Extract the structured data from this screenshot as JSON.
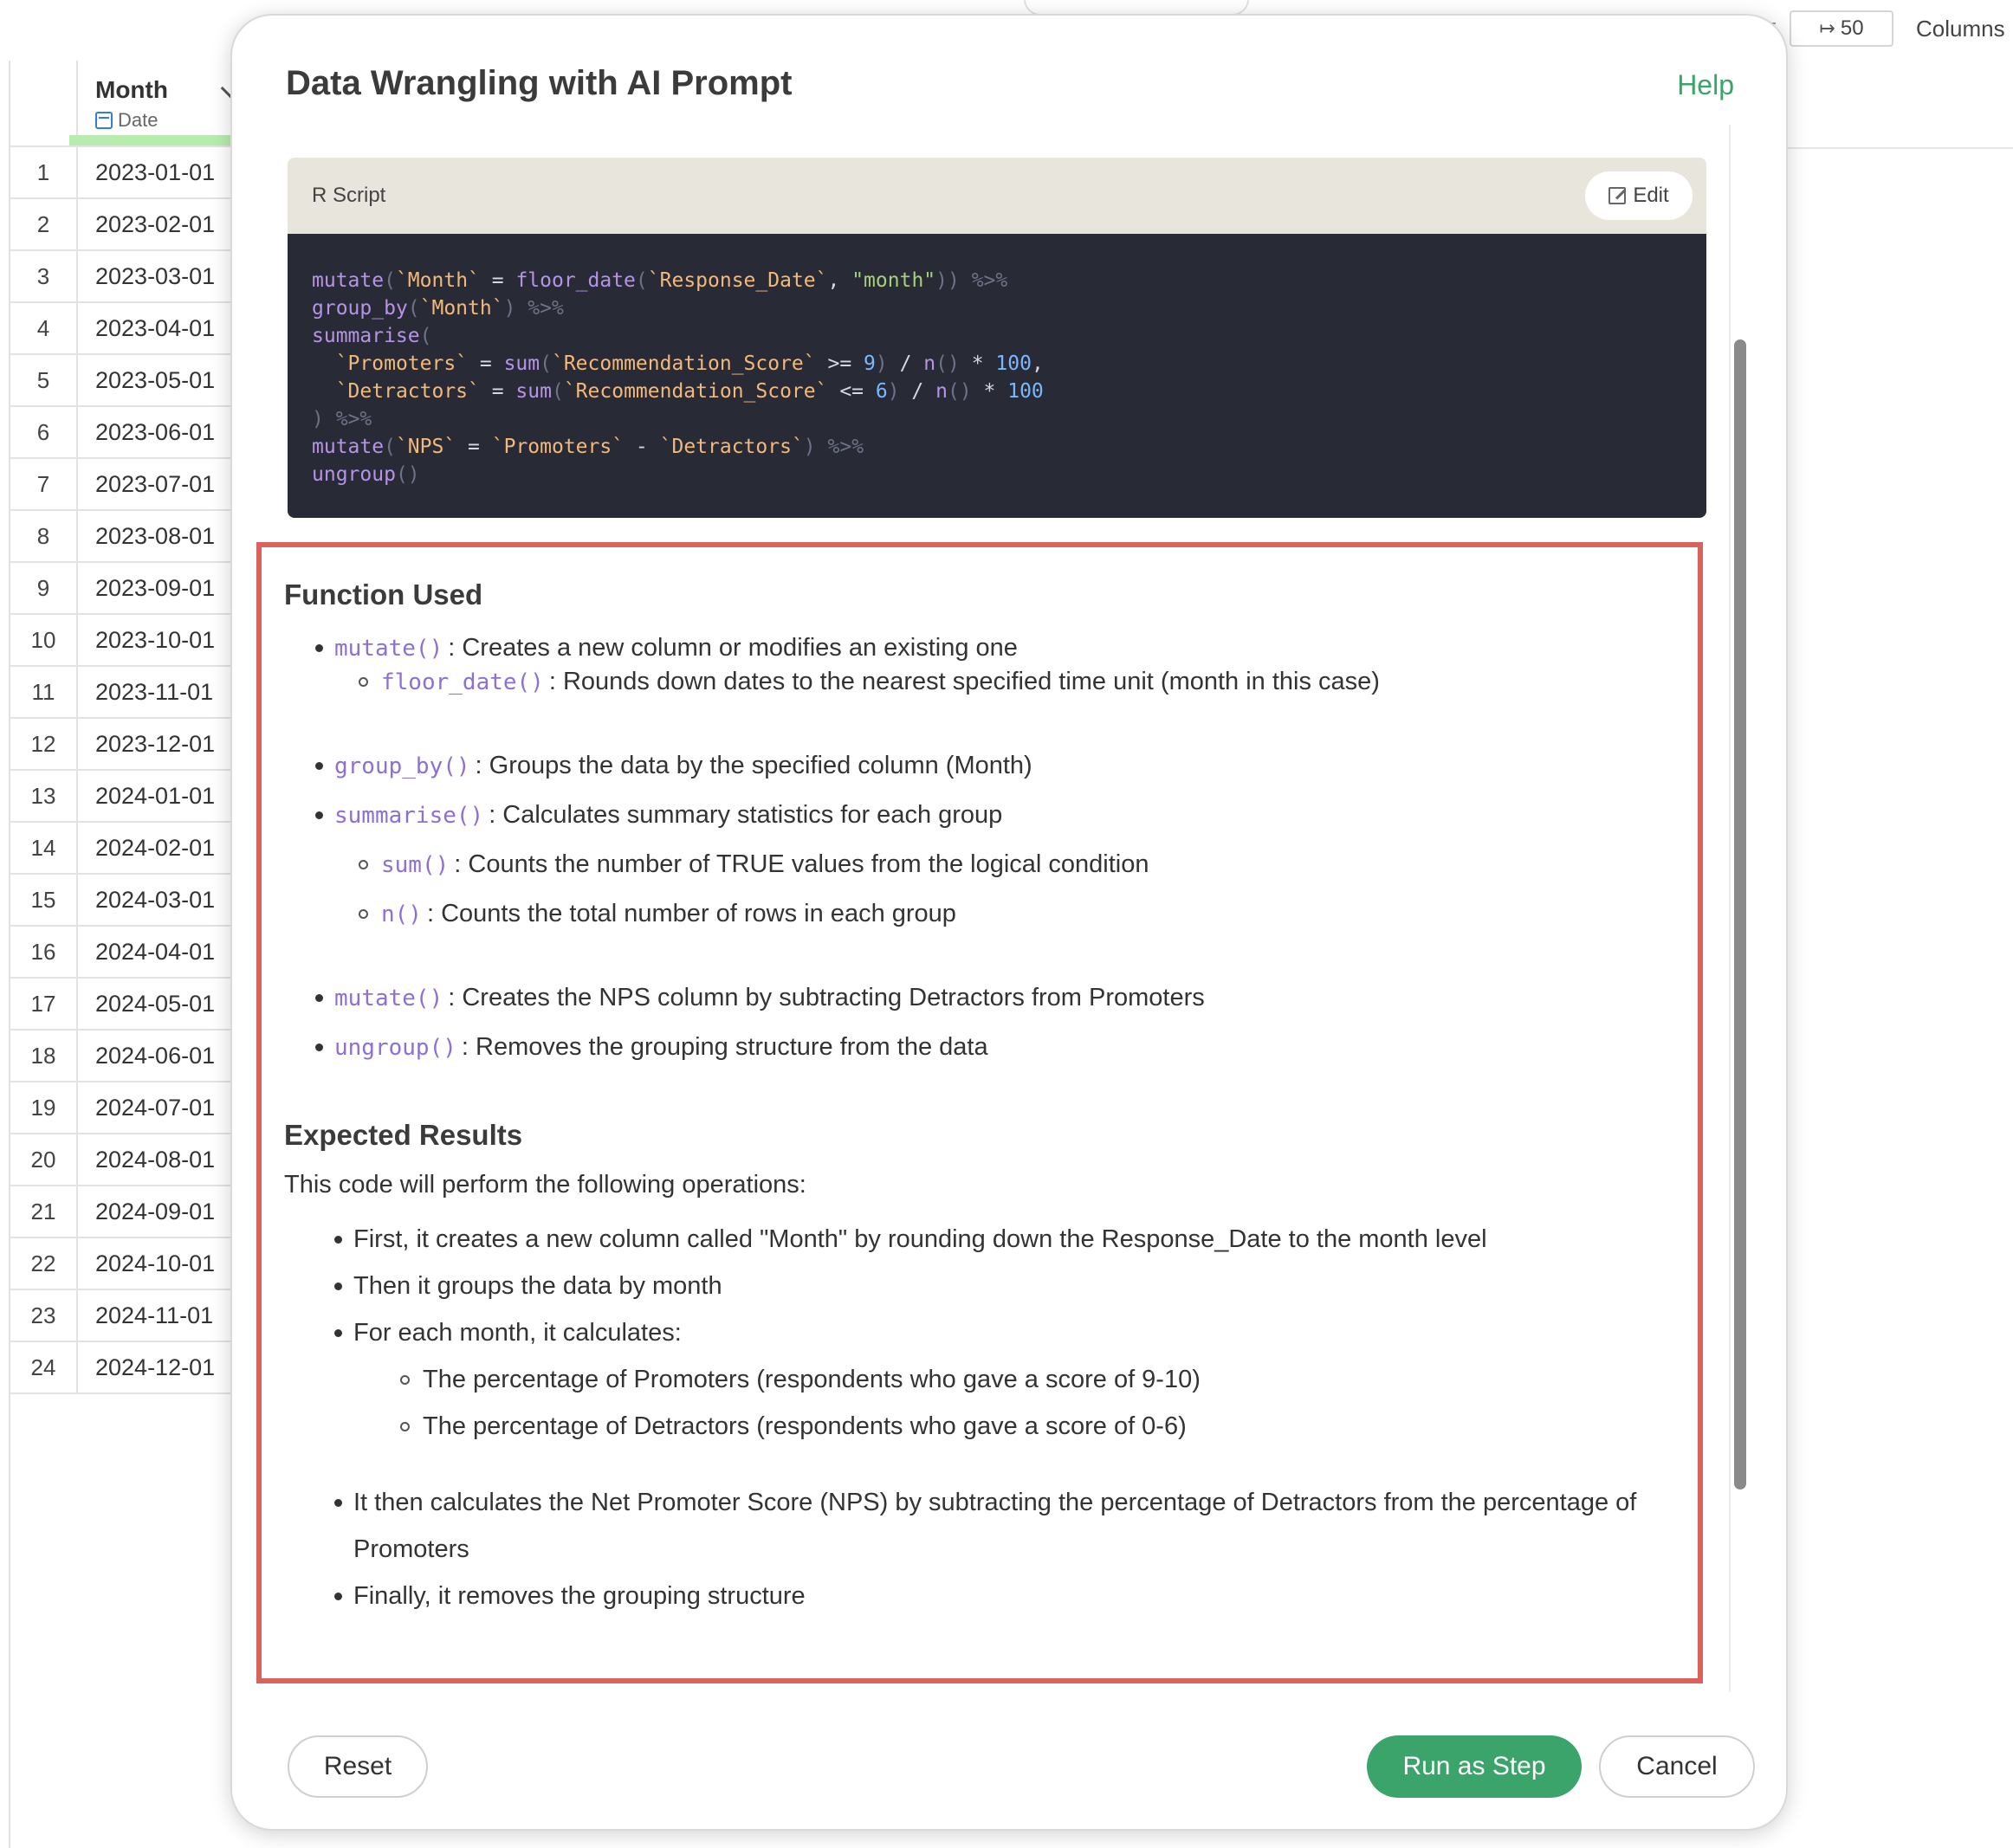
{
  "toolbar": {
    "rows_value": "50",
    "columns_label": "Columns"
  },
  "grid": {
    "column_name": "Month",
    "column_type": "Date",
    "rows": [
      {
        "idx": "1",
        "value": "2023-01-01"
      },
      {
        "idx": "2",
        "value": "2023-02-01"
      },
      {
        "idx": "3",
        "value": "2023-03-01"
      },
      {
        "idx": "4",
        "value": "2023-04-01"
      },
      {
        "idx": "5",
        "value": "2023-05-01"
      },
      {
        "idx": "6",
        "value": "2023-06-01"
      },
      {
        "idx": "7",
        "value": "2023-07-01"
      },
      {
        "idx": "8",
        "value": "2023-08-01"
      },
      {
        "idx": "9",
        "value": "2023-09-01"
      },
      {
        "idx": "10",
        "value": "2023-10-01"
      },
      {
        "idx": "11",
        "value": "2023-11-01"
      },
      {
        "idx": "12",
        "value": "2023-12-01"
      },
      {
        "idx": "13",
        "value": "2024-01-01"
      },
      {
        "idx": "14",
        "value": "2024-02-01"
      },
      {
        "idx": "15",
        "value": "2024-03-01"
      },
      {
        "idx": "16",
        "value": "2024-04-01"
      },
      {
        "idx": "17",
        "value": "2024-05-01"
      },
      {
        "idx": "18",
        "value": "2024-06-01"
      },
      {
        "idx": "19",
        "value": "2024-07-01"
      },
      {
        "idx": "20",
        "value": "2024-08-01"
      },
      {
        "idx": "21",
        "value": "2024-09-01"
      },
      {
        "idx": "22",
        "value": "2024-10-01"
      },
      {
        "idx": "23",
        "value": "2024-11-01"
      },
      {
        "idx": "24",
        "value": "2024-12-01"
      }
    ]
  },
  "modal": {
    "title": "Data Wrangling with AI Prompt",
    "help_label": "Help",
    "script_label": "R Script",
    "edit_label": "Edit",
    "code_lines": [
      [
        [
          "fn",
          "mutate"
        ],
        [
          "pun",
          "("
        ],
        [
          "bt",
          "`Month`"
        ],
        [
          "op",
          " = "
        ],
        [
          "fn",
          "floor_date"
        ],
        [
          "pun",
          "("
        ],
        [
          "bt",
          "`Response_Date`"
        ],
        [
          "op",
          ", "
        ],
        [
          "str",
          "\"month\""
        ],
        [
          "pun",
          "))"
        ],
        [
          "op",
          " "
        ],
        [
          "pun",
          "%>%"
        ]
      ],
      [
        [
          "fn",
          "group_by"
        ],
        [
          "pun",
          "("
        ],
        [
          "bt",
          "`Month`"
        ],
        [
          "pun",
          ")"
        ],
        [
          "op",
          " "
        ],
        [
          "pun",
          "%>%"
        ]
      ],
      [
        [
          "fn",
          "summarise"
        ],
        [
          "pun",
          "("
        ]
      ],
      [
        [
          "op",
          "  "
        ],
        [
          "bt",
          "`Promoters`"
        ],
        [
          "op",
          " = "
        ],
        [
          "fn",
          "sum"
        ],
        [
          "pun",
          "("
        ],
        [
          "bt",
          "`Recommendation_Score`"
        ],
        [
          "op",
          " >= "
        ],
        [
          "num",
          "9"
        ],
        [
          "pun",
          ")"
        ],
        [
          "op",
          " / "
        ],
        [
          "fn",
          "n"
        ],
        [
          "pun",
          "()"
        ],
        [
          "op",
          " * "
        ],
        [
          "num",
          "100"
        ],
        [
          "op",
          ","
        ]
      ],
      [
        [
          "op",
          "  "
        ],
        [
          "bt",
          "`Detractors`"
        ],
        [
          "op",
          " = "
        ],
        [
          "fn",
          "sum"
        ],
        [
          "pun",
          "("
        ],
        [
          "bt",
          "`Recommendation_Score`"
        ],
        [
          "op",
          " <= "
        ],
        [
          "num",
          "6"
        ],
        [
          "pun",
          ")"
        ],
        [
          "op",
          " / "
        ],
        [
          "fn",
          "n"
        ],
        [
          "pun",
          "()"
        ],
        [
          "op",
          " * "
        ],
        [
          "num",
          "100"
        ]
      ],
      [
        [
          "pun",
          ")"
        ],
        [
          "op",
          " "
        ],
        [
          "pun",
          "%>%"
        ]
      ],
      [
        [
          "fn",
          "mutate"
        ],
        [
          "pun",
          "("
        ],
        [
          "bt",
          "`NPS`"
        ],
        [
          "op",
          " = "
        ],
        [
          "bt",
          "`Promoters`"
        ],
        [
          "op",
          " - "
        ],
        [
          "bt",
          "`Detractors`"
        ],
        [
          "pun",
          ")"
        ],
        [
          "op",
          " "
        ],
        [
          "pun",
          "%>%"
        ]
      ],
      [
        [
          "fn",
          "ungroup"
        ],
        [
          "pun",
          "()"
        ]
      ]
    ],
    "function_used": {
      "heading": "Function Used",
      "items": [
        {
          "fn": "mutate()",
          "text": ": Creates a new column or modifies an existing one"
        },
        {
          "fn": "floor_date()",
          "text": ": Rounds down dates to the nearest specified time unit (month in this case)"
        },
        {
          "fn": "group_by()",
          "text": ": Groups the data by the specified column (Month)"
        },
        {
          "fn": "summarise()",
          "text": ": Calculates summary statistics for each group"
        },
        {
          "fn": "sum()",
          "text": ": Counts the number of TRUE values from the logical condition"
        },
        {
          "fn": "n()",
          "text": ": Counts the total number of rows in each group"
        },
        {
          "fn": "mutate()",
          "text": ": Creates the NPS column by subtracting Detractors from Promoters"
        },
        {
          "fn": "ungroup()",
          "text": ": Removes the grouping structure from the data"
        }
      ]
    },
    "expected_results": {
      "heading": "Expected Results",
      "intro": "This code will perform the following operations:",
      "items": [
        "First, it creates a new column called \"Month\" by rounding down the Response_Date to the month level",
        "Then it groups the data by month",
        "For each month, it calculates:",
        "The percentage of Promoters (respondents who gave a score of 9-10)",
        "The percentage of Detractors (respondents who gave a score of 0-6)",
        "It then calculates the Net Promoter Score (NPS) by subtracting the percentage of Detractors from the percentage of",
        "Promoters",
        "Finally, it removes the grouping structure"
      ]
    },
    "buttons": {
      "reset": "Reset",
      "run": "Run as Step",
      "cancel": "Cancel"
    }
  }
}
